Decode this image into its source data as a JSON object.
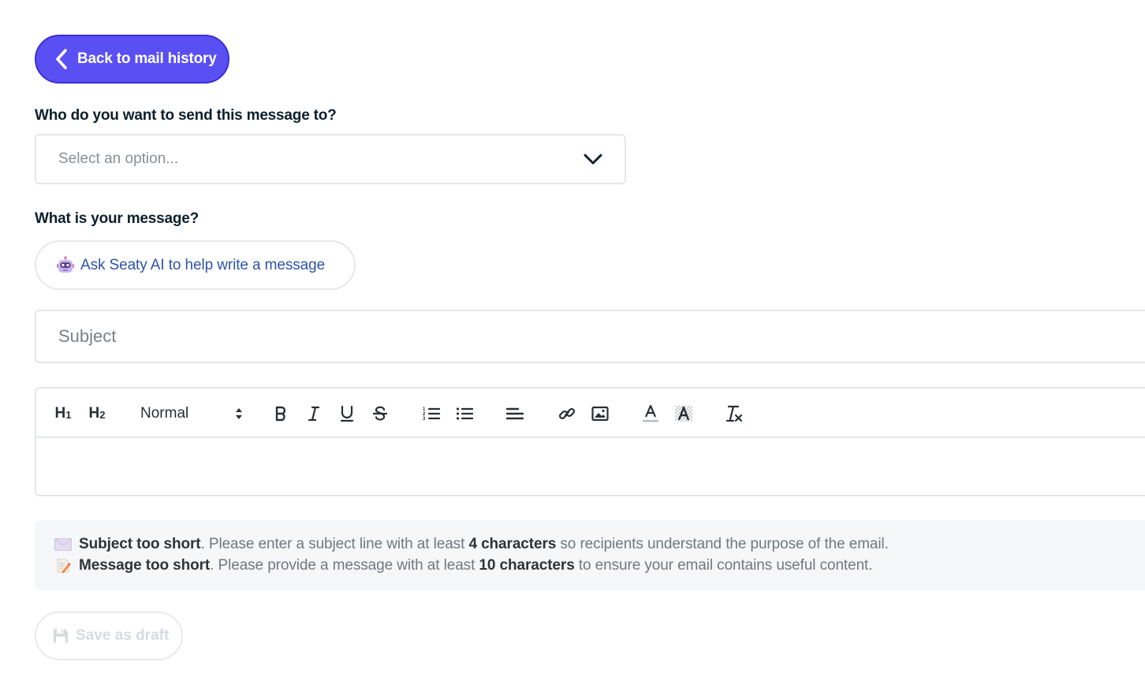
{
  "back_button": {
    "label": "Back to mail history",
    "icon": "chevron-left-icon"
  },
  "recipient": {
    "label": "Who do you want to send this message to?",
    "placeholder": "Select an option...",
    "icon": "chevron-down-icon"
  },
  "message": {
    "label": "What is your message?",
    "ai_button": {
      "label": "Ask Seaty AI to help write a message",
      "icon": "robot-icon"
    },
    "subject_placeholder": "Subject",
    "body_value": ""
  },
  "toolbar": {
    "h1": "H",
    "h1_sub": "1",
    "h2": "H",
    "h2_sub": "2",
    "format_value": "Normal",
    "icons": [
      "bold-icon",
      "italic-icon",
      "underline-icon",
      "strikethrough-icon",
      "ordered-list-icon",
      "bullet-list-icon",
      "align-icon",
      "link-icon",
      "image-icon",
      "font-color-icon",
      "background-color-icon",
      "clear-formatting-icon"
    ]
  },
  "validation": {
    "subject": {
      "icon": "envelope-icon",
      "title": "Subject too short",
      "text_1": ". Please enter a subject line with at least ",
      "emphasis": "4 characters",
      "text_2": " so recipients understand the purpose of the email."
    },
    "message": {
      "icon": "memo-icon",
      "title": "Message too short",
      "text_1": ". Please provide a message with at least ",
      "emphasis": "10 characters",
      "text_2": " to ensure your email contains useful content."
    }
  },
  "draft_button": {
    "label": "Save as draft",
    "icon": "floppy-disk-icon",
    "disabled": true
  },
  "colors": {
    "primary": "#5a4ff3",
    "link_blue": "#2e54a8",
    "text_dark": "#0c1f2c",
    "notice_bg": "#f6f7f8"
  }
}
